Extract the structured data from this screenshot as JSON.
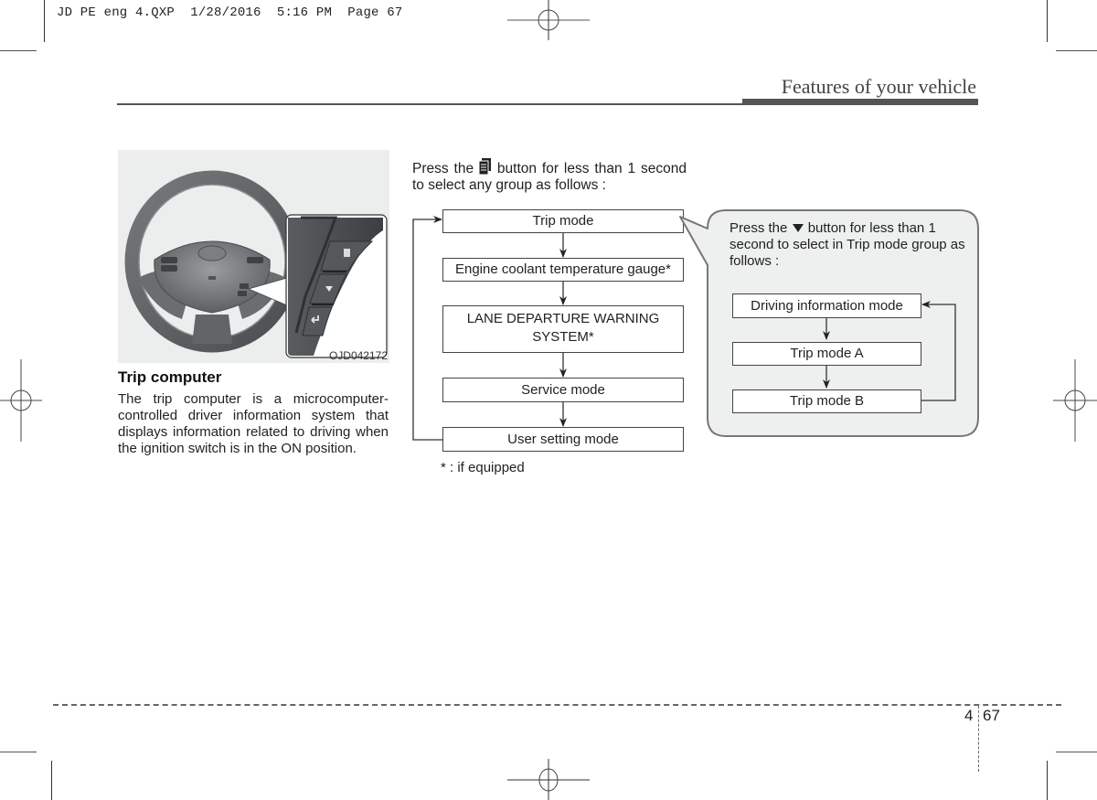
{
  "print_slug": {
    "text": "JD PE eng 4.QXP  1/28/2016  5:16 PM  Page 67"
  },
  "header": {
    "section_title": "Features of your vehicle"
  },
  "figure": {
    "code": "OJD042172",
    "description": "Steering wheel with trip computer control buttons (mode, move/down, select/reset)",
    "buttons": [
      {
        "icon": "mode-icon"
      },
      {
        "icon": "triangle-down-icon"
      },
      {
        "icon": "enter-return-icon"
      }
    ]
  },
  "left_column": {
    "heading": "Trip computer",
    "body": "The trip computer is a microcomputer-controlled driver information system that displays information related to driving when the ignition switch is in the ON position."
  },
  "main_flow": {
    "intro_before_icon": "Press the ",
    "intro_icon": "mode-button-icon",
    "intro_after_icon": " button for less than 1 second to select any group as follows :",
    "steps": [
      {
        "label": "Trip mode"
      },
      {
        "label": "Engine coolant temperature gauge*"
      },
      {
        "label": "LANE DEPARTURE WARNING SYSTEM*"
      },
      {
        "label": "Service mode"
      },
      {
        "label": "User setting mode"
      }
    ],
    "footnote": "* : if equipped"
  },
  "sub_flow": {
    "intro_before_icon": "Press the ",
    "intro_icon": "down-triangle-button-icon",
    "intro_after_icon": " button for less than 1 second to select in Trip mode group as follows :",
    "steps": [
      {
        "label": "Driving information mode"
      },
      {
        "label": "Trip mode A"
      },
      {
        "label": "Trip mode B"
      }
    ]
  },
  "footer": {
    "chapter": "4",
    "page": "67"
  },
  "colors": {
    "rule": "#555555",
    "bubble_fill": "#eeefef",
    "bubble_stroke": "#777777",
    "photo_bg": "#eceeee"
  }
}
